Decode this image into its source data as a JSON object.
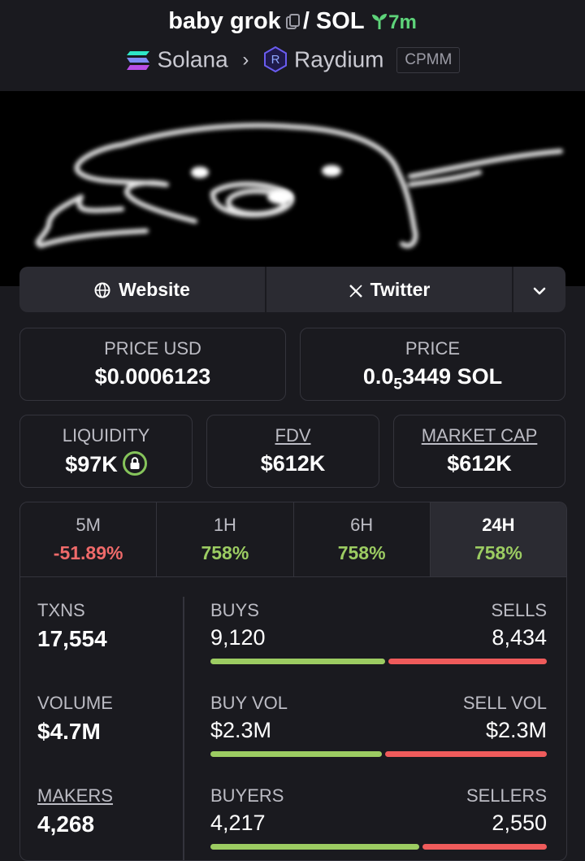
{
  "header": {
    "token_name": "baby grok",
    "pair_quote": "/ SOL",
    "age": "7m",
    "chain": "Solana",
    "dex": "Raydium",
    "pool_type": "CPMM"
  },
  "links": {
    "website": "Website",
    "twitter": "Twitter"
  },
  "price_usd": {
    "label": "PRICE USD",
    "value": "$0.0006123"
  },
  "price_native": {
    "label": "PRICE",
    "prefix": "0.0",
    "subscript": "5",
    "digits": "3449",
    "unit": "SOL"
  },
  "liquidity": {
    "label": "LIQUIDITY",
    "value": "$97K"
  },
  "fdv": {
    "label": "FDV",
    "value": "$612K"
  },
  "market_cap": {
    "label": "MARKET CAP",
    "value": "$612K"
  },
  "tabs": [
    {
      "label": "5M",
      "value": "-51.89%"
    },
    {
      "label": "1H",
      "value": "758%"
    },
    {
      "label": "6H",
      "value": "758%"
    },
    {
      "label": "24H",
      "value": "758%"
    }
  ],
  "txns": {
    "label": "TXNS",
    "value": "17,554"
  },
  "volume": {
    "label": "VOLUME",
    "value": "$4.7M"
  },
  "makers": {
    "label": "MAKERS",
    "value": "4,268"
  },
  "buys": {
    "label": "BUYS",
    "value": "9,120"
  },
  "sells": {
    "label": "SELLS",
    "value": "8,434"
  },
  "buy_vol": {
    "label": "BUY VOL",
    "value": "$2.3M"
  },
  "sell_vol": {
    "label": "SELL VOL",
    "value": "$2.3M"
  },
  "buyers": {
    "label": "BUYERS",
    "value": "4,217"
  },
  "sellers": {
    "label": "SELLERS",
    "value": "2,550"
  },
  "ratios": {
    "buys_share": 0.52,
    "buy_vol_share": 0.51,
    "buyers_share": 0.62
  },
  "colors": {
    "positive": "#9ccc62",
    "negative": "#ef6a6a",
    "accent_green": "#5ed47a"
  }
}
